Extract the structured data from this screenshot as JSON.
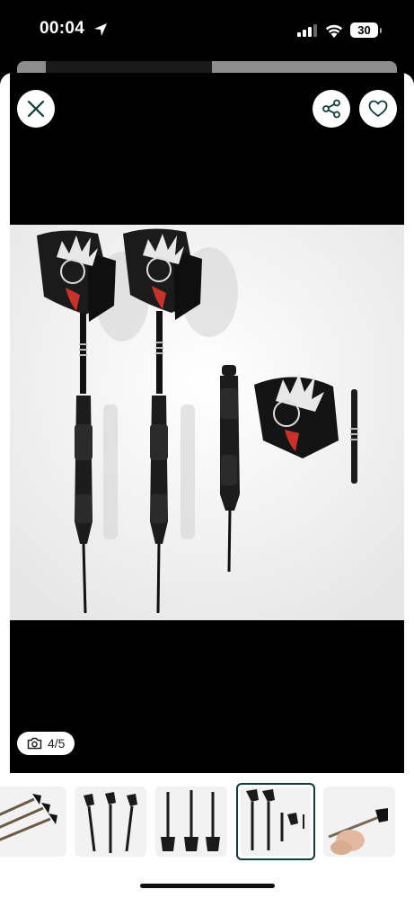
{
  "status_bar": {
    "time": "00:04",
    "battery": "30"
  },
  "viewer": {
    "close_icon": "close-icon",
    "share_icon": "share-icon",
    "favorite_icon": "heart-icon",
    "photo_counter": "4/5",
    "camera_icon": "camera-icon",
    "background": "#000000"
  },
  "thumbnails": [
    {
      "index": 1,
      "selected": false
    },
    {
      "index": 2,
      "selected": false
    },
    {
      "index": 3,
      "selected": false
    },
    {
      "index": 4,
      "selected": true
    },
    {
      "index": 5,
      "selected": false
    }
  ],
  "colors": {
    "accent": "#0f3d3a",
    "flight_red": "#c8322a"
  }
}
